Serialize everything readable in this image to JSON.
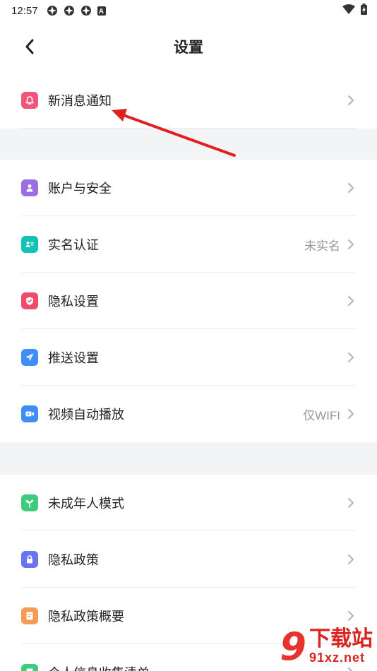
{
  "statusbar": {
    "time": "12:57",
    "notif_badge": "A"
  },
  "header": {
    "title": "设置"
  },
  "groups": [
    {
      "items": [
        {
          "label": "新消息通知",
          "value": "",
          "icon": "bell-icon",
          "color": "#f0557a"
        }
      ]
    },
    {
      "items": [
        {
          "label": "账户与安全",
          "value": "",
          "icon": "person-icon",
          "color": "#9b6ee2"
        },
        {
          "label": "实名认证",
          "value": "未实名",
          "icon": "id-card-icon",
          "color": "#14c1b7"
        },
        {
          "label": "隐私设置",
          "value": "",
          "icon": "shield-icon",
          "color": "#f24a6b"
        },
        {
          "label": "推送设置",
          "value": "",
          "icon": "send-icon",
          "color": "#3e8ef5"
        },
        {
          "label": "视频自动播放",
          "value": "仅WIFI",
          "icon": "video-icon",
          "color": "#3e8ef5"
        }
      ]
    },
    {
      "items": [
        {
          "label": "未成年人模式",
          "value": "",
          "icon": "sprout-icon",
          "color": "#3ecb7e"
        },
        {
          "label": "隐私政策",
          "value": "",
          "icon": "lock-icon",
          "color": "#6a74f2"
        },
        {
          "label": "隐私政策概要",
          "value": "",
          "icon": "document-icon",
          "color": "#f59b55"
        },
        {
          "label": "个人信息收集清单",
          "value": "",
          "icon": "list-icon",
          "color": "#3ecb7e"
        }
      ]
    }
  ],
  "watermark": {
    "glyph": "9",
    "cn": "下载站",
    "url": "91xz.net"
  },
  "colors": {
    "arrow": "#e02020",
    "chevron": "#b3b3b3"
  }
}
